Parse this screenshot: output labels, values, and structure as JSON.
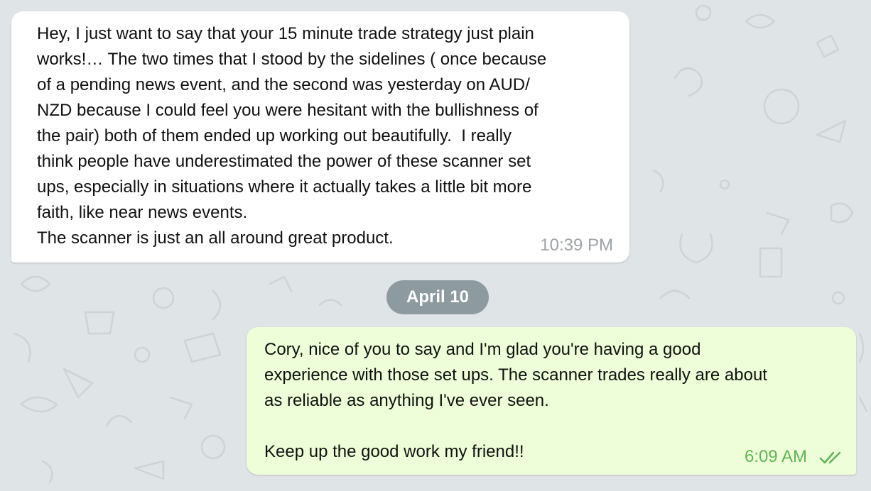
{
  "chat": {
    "messages": [
      {
        "direction": "incoming",
        "text": "Hey, I just want to say that your 15 minute trade strategy just plain\nworks!… The two times that I stood by the sidelines ( once because\nof a pending news event, and the second was yesterday on AUD/\nNZD because I could feel you were hesitant with the bullishness of\nthe pair) both of them ended up working out beautifully.  I really\nthink people have underestimated the power of these scanner set\nups, especially in situations where it actually takes a little bit more\nfaith, like near news events.\nThe scanner is just an all around great product.",
        "time": "10:39 PM"
      },
      {
        "direction": "outgoing",
        "text": "Cory, nice of you to say and I'm glad you're having a good\nexperience with those set ups. The scanner trades really are about\nas reliable as anything I've ever seen.\n\nKeep up the good work my friend!!",
        "time": "6:09 AM",
        "status_icon": "double-check-icon"
      }
    ],
    "date_separator": "April 10"
  },
  "colors": {
    "background": "#dfe4e6",
    "incoming_bubble": "#ffffff",
    "outgoing_bubble": "#eefed8",
    "incoming_time": "#9ea3a7",
    "outgoing_time": "#5fb554",
    "date_pill": "#8d9aa0"
  }
}
